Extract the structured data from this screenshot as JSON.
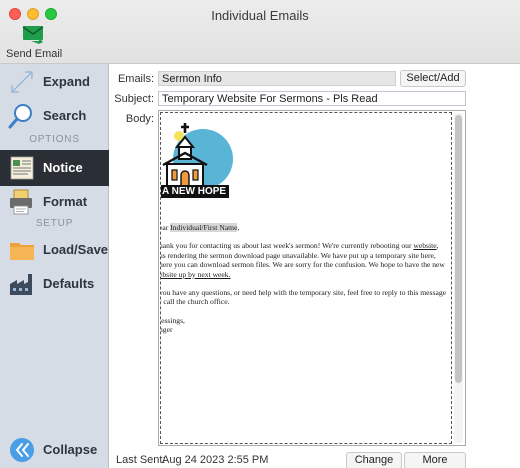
{
  "window": {
    "title": "Individual Emails"
  },
  "toolbar": {
    "send_label": "Send Email"
  },
  "sidebar": {
    "items": [
      {
        "label": "Expand"
      },
      {
        "label": "Search"
      },
      {
        "label": "Notice"
      },
      {
        "label": "Format"
      },
      {
        "label": "Load/Save"
      },
      {
        "label": "Defaults"
      },
      {
        "label": "Collapse"
      }
    ],
    "options_heading": "OPTIONS",
    "setup_heading": "SETUP"
  },
  "form": {
    "emails_label": "Emails:",
    "emails_value": "Sermon Info",
    "select_add_label": "Select/Add",
    "subject_label": "Subject:",
    "subject_value": "Temporary Website For Sermons - Pls Read",
    "body_label": "Body:"
  },
  "letter": {
    "logo_text": "A NEW HOPE",
    "greeting_prefix": "ear ",
    "greeting_field": "Individual/First Name",
    "greeting_suffix": ",",
    "para1": [
      "hank you for contacting us about last week's sermon! We're currently rebooting our website,",
      "us rendering the sermon download page unavailable. We have put up a temporary site here,",
      "here you can download sermon files. We are sorry for the confusion. We hope to have the new",
      "ebsite up by next week."
    ],
    "para2": [
      " you have any questions, or need help with the temporary site, feel free to reply to this message",
      "r call the church office."
    ],
    "closing": "lessings,",
    "signature": "nger"
  },
  "footer": {
    "last_sent_label": "Last Sent:",
    "last_sent_value": "Aug 24 2023 2:55 PM",
    "change_label": "Change",
    "more_options_label": "More Options"
  },
  "colors": {
    "sidebar_bg": "#d5dce5",
    "active_item_bg": "#2a2f36",
    "logo_circle": "#5ab4d6"
  }
}
